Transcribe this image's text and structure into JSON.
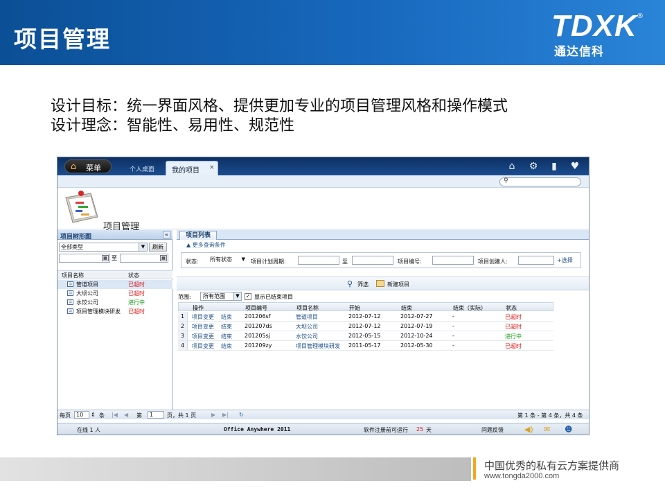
{
  "slide": {
    "title": "项目管理",
    "logo_text": "TDXK",
    "logo_reg": "®",
    "logo_subtitle": "通达信科",
    "intro_line1": "设计目标：统一界面风格、提供更加专业的项目管理风格和操作模式",
    "intro_line2": "设计理念：智能性、易用性、规范性"
  },
  "app": {
    "menu_label": "菜单",
    "tab_desktop": "个人桌面",
    "tab_mine": "我的项目",
    "tab_close": "×",
    "page_heading": "项目管理",
    "left": {
      "title": "项目树形图",
      "collapse": "«",
      "type_select": "全部类型",
      "refresh": "刷新",
      "date_sep": "至",
      "col_name": "项目名称",
      "col_status": "状态",
      "rows": [
        {
          "name": "管道项目",
          "status": "已超时"
        },
        {
          "name": "大坝公司",
          "status": "已超时"
        },
        {
          "name": "水饺公司",
          "status": "进行中"
        },
        {
          "name": "项目管理模块研发",
          "status": "已超时"
        }
      ]
    },
    "right": {
      "tab": "项目列表",
      "more_conditions": "▲ 更多查询条件",
      "filter_status_label": "状态:",
      "filter_status_value": "所有状态",
      "filter_period_label": "项目计划周期:",
      "filter_period_sep": "至",
      "filter_code_label": "项目编号:",
      "filter_creator_label": "项目创建人:",
      "select_link": "+选择",
      "filter_btn": "筛选",
      "new_btn": "新建项目",
      "scope_label": "范围:",
      "scope_value": "所有范围",
      "show_ended": "显示已结束项目",
      "grid_headers": [
        "操作",
        "项目编号",
        "项目名称",
        "开始",
        "结束",
        "结束（实际）",
        "状态"
      ],
      "grid_rows": [
        {
          "n": "1",
          "op1": "项目变更",
          "op2": "结束",
          "code": "201206sf",
          "name": "管道项目",
          "start": "2012-07-12",
          "end": "2012-07-27",
          "actual": "-",
          "status": "已超时"
        },
        {
          "n": "2",
          "op1": "项目变更",
          "op2": "结束",
          "code": "201207ds",
          "name": "大坝公司",
          "start": "2012-07-12",
          "end": "2012-07-19",
          "actual": "-",
          "status": "已超时"
        },
        {
          "n": "3",
          "op1": "项目变更",
          "op2": "结束",
          "code": "201205sj",
          "name": "水饺公司",
          "start": "2012-05-15",
          "end": "2012-10-24",
          "actual": "-",
          "status": "进行中"
        },
        {
          "n": "4",
          "op1": "项目变更",
          "op2": "结束",
          "code": "201209zy",
          "name": "项目管理模块研发",
          "start": "2011-05-17",
          "end": "2012-05-30",
          "actual": "-",
          "status": "已超时"
        }
      ]
    },
    "pager": {
      "per_page_label": "每页",
      "per_page": "10",
      "per_page_unit": "条",
      "page_prefix": "第",
      "page": "1",
      "page_suffix": "页，共 1 页",
      "summary": "第 1 条 - 第 4 条，共 4 条"
    },
    "statusbar": {
      "online": "在线  1  人",
      "product": "Office Anywhere 2011",
      "trial_prefix": "软件注册前可运行",
      "trial_days": "25",
      "trial_unit": "天",
      "feedback": "问题反馈"
    },
    "colors": {
      "red": "#e01818",
      "green": "#1a9a1a",
      "link": "#1d4f8a"
    }
  },
  "footer": {
    "slogan": "中国优秀的私有云方案提供商",
    "url": "www.tongda2000.com"
  }
}
